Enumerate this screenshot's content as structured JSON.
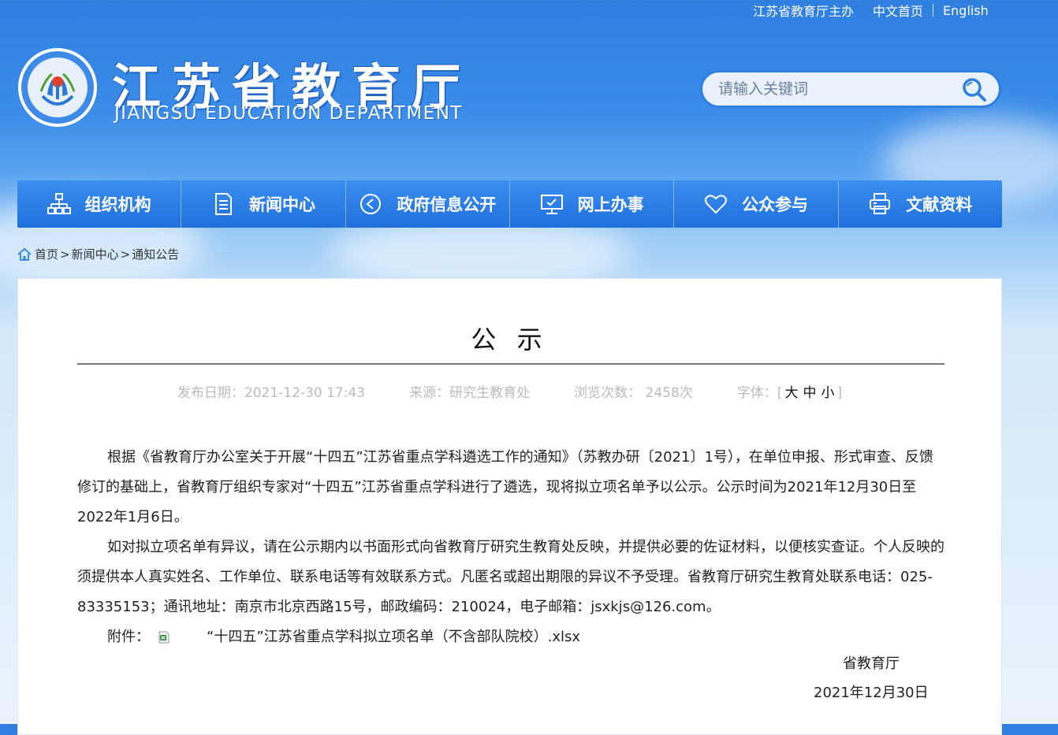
{
  "top_links": {
    "sponsor": "江苏省教育厅主办",
    "chinese_home": "中文首页",
    "english": "English"
  },
  "header": {
    "title_cn": "江苏省教育厅",
    "title_en": "JIANGSU EDUCATION DEPARTMENT",
    "logo_icon": "jiangsu-education-emblem-icon"
  },
  "search": {
    "placeholder": "请输入关键词",
    "icon": "search-icon"
  },
  "nav": {
    "items": [
      {
        "label": "组织机构",
        "icon": "org-chart-icon"
      },
      {
        "label": "新闻中心",
        "icon": "document-icon"
      },
      {
        "label": "政府信息公开",
        "icon": "play-circle-icon"
      },
      {
        "label": "网上办事",
        "icon": "monitor-icon"
      },
      {
        "label": "公众参与",
        "icon": "heart-icon"
      },
      {
        "label": "文献资料",
        "icon": "printer-icon"
      }
    ]
  },
  "breadcrumb": {
    "home": "首页",
    "news": "新闻中心",
    "current": "通知公告",
    "separator": ">"
  },
  "article": {
    "title": "公 示",
    "publish_date": "发布日期：2021-12-30 17:43",
    "source": "来源：研究生教育处",
    "views": "浏览次数： 2458次",
    "font_size_label": "字体：[",
    "font_size_end": "]",
    "font_large": "大",
    "font_medium": "中",
    "font_small": "小",
    "paragraph1": "根据《省教育厅办公室关于开展“十四五”江苏省重点学科遴选工作的通知》（苏教办研〔2021〕1号），在单位申报、形式审查、反馈修订的基础上，省教育厅组织专家对“十四五”江苏省重点学科进行了遴选，现将拟立项名单予以公示。公示时间为2021年12月30日至2022年1月6日。",
    "paragraph2": "如对拟立项名单有异议，请在公示期内以书面形式向省教育厅研究生教育处反映，并提供必要的佐证材料，以便核实查证。个人反映的须提供本人真实姓名、工作单位、联系电话等有效联系方式。凡匿名或超出期限的异议不予受理。省教育厅研究生教育处联系电话：025-83335153；通讯地址：南京市北京西路15号，邮政编码：210024，电子邮箱：jsxkjs@126.com。",
    "attachment_label": "附件：",
    "attachment_file": "“十四五”江苏省重点学科拟立项名单（不含部队院校）.xlsx",
    "signature": "省教育厅",
    "date": "2021年12月30日"
  },
  "colors": {
    "nav_bg": "#1f6fdd",
    "header_bg": "#2f7fe0",
    "search_border": "#2d7fe3"
  }
}
